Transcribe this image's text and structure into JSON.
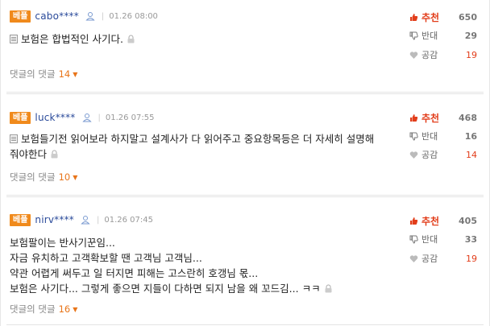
{
  "badge_label": "베플",
  "vote_labels": {
    "up": "추천",
    "down": "반대",
    "good": "공감"
  },
  "reply_label": "댓글의 댓글",
  "colors": {
    "badge": "#f08a1c",
    "accent": "#e8751a",
    "up": "#e23d1a",
    "user": "#2a4a9a"
  },
  "comments": [
    {
      "user": "cabo****",
      "time": "01.26 08:00",
      "lines": [
        "보험은 합법적인 사기다."
      ],
      "replies": "14",
      "up": "650",
      "down": "29",
      "good": "19"
    },
    {
      "user": "luck****",
      "time": "01.26 07:55",
      "lines": [
        "보험들기전 읽어보라 하지말고 설계사가 다 읽어주고 중요항목등은 더 자세히 설명해",
        "줘야한다"
      ],
      "replies": "10",
      "up": "468",
      "down": "16",
      "good": "14"
    },
    {
      "user": "nirv****",
      "time": "01.26 07:45",
      "lines": [
        "보험팔이는 반사기꾼임...",
        "자금 유치하고 고객확보할 땐 고객님 고객님...",
        "약관 어렵게 써두고 일 터지면 피해는 고스란히 호갱님 몫...",
        "보험은 사기다... 그렇게 좋으면 지들이 다하면 되지 남을 왜 꼬드김... ㅋㅋ"
      ],
      "replies": "16",
      "up": "405",
      "down": "33",
      "good": "19"
    }
  ]
}
